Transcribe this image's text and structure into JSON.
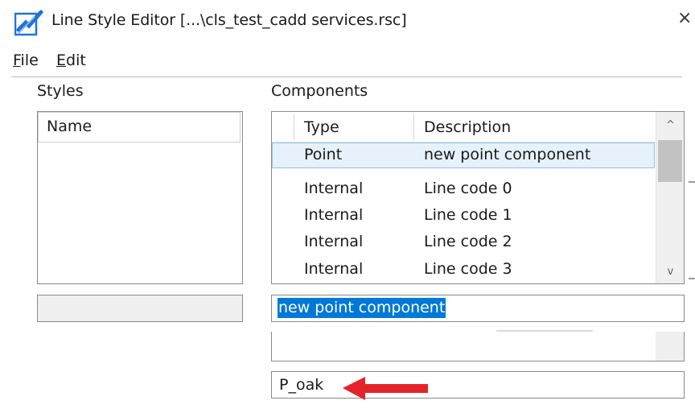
{
  "window": {
    "title": "Line Style Editor [...\\cls_test_cadd services.rsc]",
    "close_glyph": "×",
    "icon": "line-style-editor-icon"
  },
  "menu": {
    "file": {
      "accel": "F",
      "rest": "ile"
    },
    "edit": {
      "accel": "E",
      "rest": "dit"
    }
  },
  "styles": {
    "label": "Styles",
    "column_name": "Name",
    "items": [],
    "field_value": ""
  },
  "components": {
    "label": "Components",
    "columns": {
      "type": "Type",
      "description": "Description"
    },
    "rows": [
      {
        "type": "Point",
        "description": "new point component",
        "selected": true
      },
      {
        "type": "Internal",
        "description": "Line code 0"
      },
      {
        "type": "Internal",
        "description": "Line code 1"
      },
      {
        "type": "Internal",
        "description": "Line code 2"
      },
      {
        "type": "Internal",
        "description": "Line code 3"
      }
    ],
    "scroll_up_glyph": "^",
    "scroll_down_glyph": "v",
    "description_field": "new point component"
  },
  "name_field": {
    "value": "P_oak"
  },
  "colors": {
    "selection_row_bg": "#e6f1fb",
    "selection_row_border": "#8fc4ec",
    "text_selection": "#0078d7",
    "arrow": "#e3242b",
    "icon_blue": "#1e73d8"
  }
}
